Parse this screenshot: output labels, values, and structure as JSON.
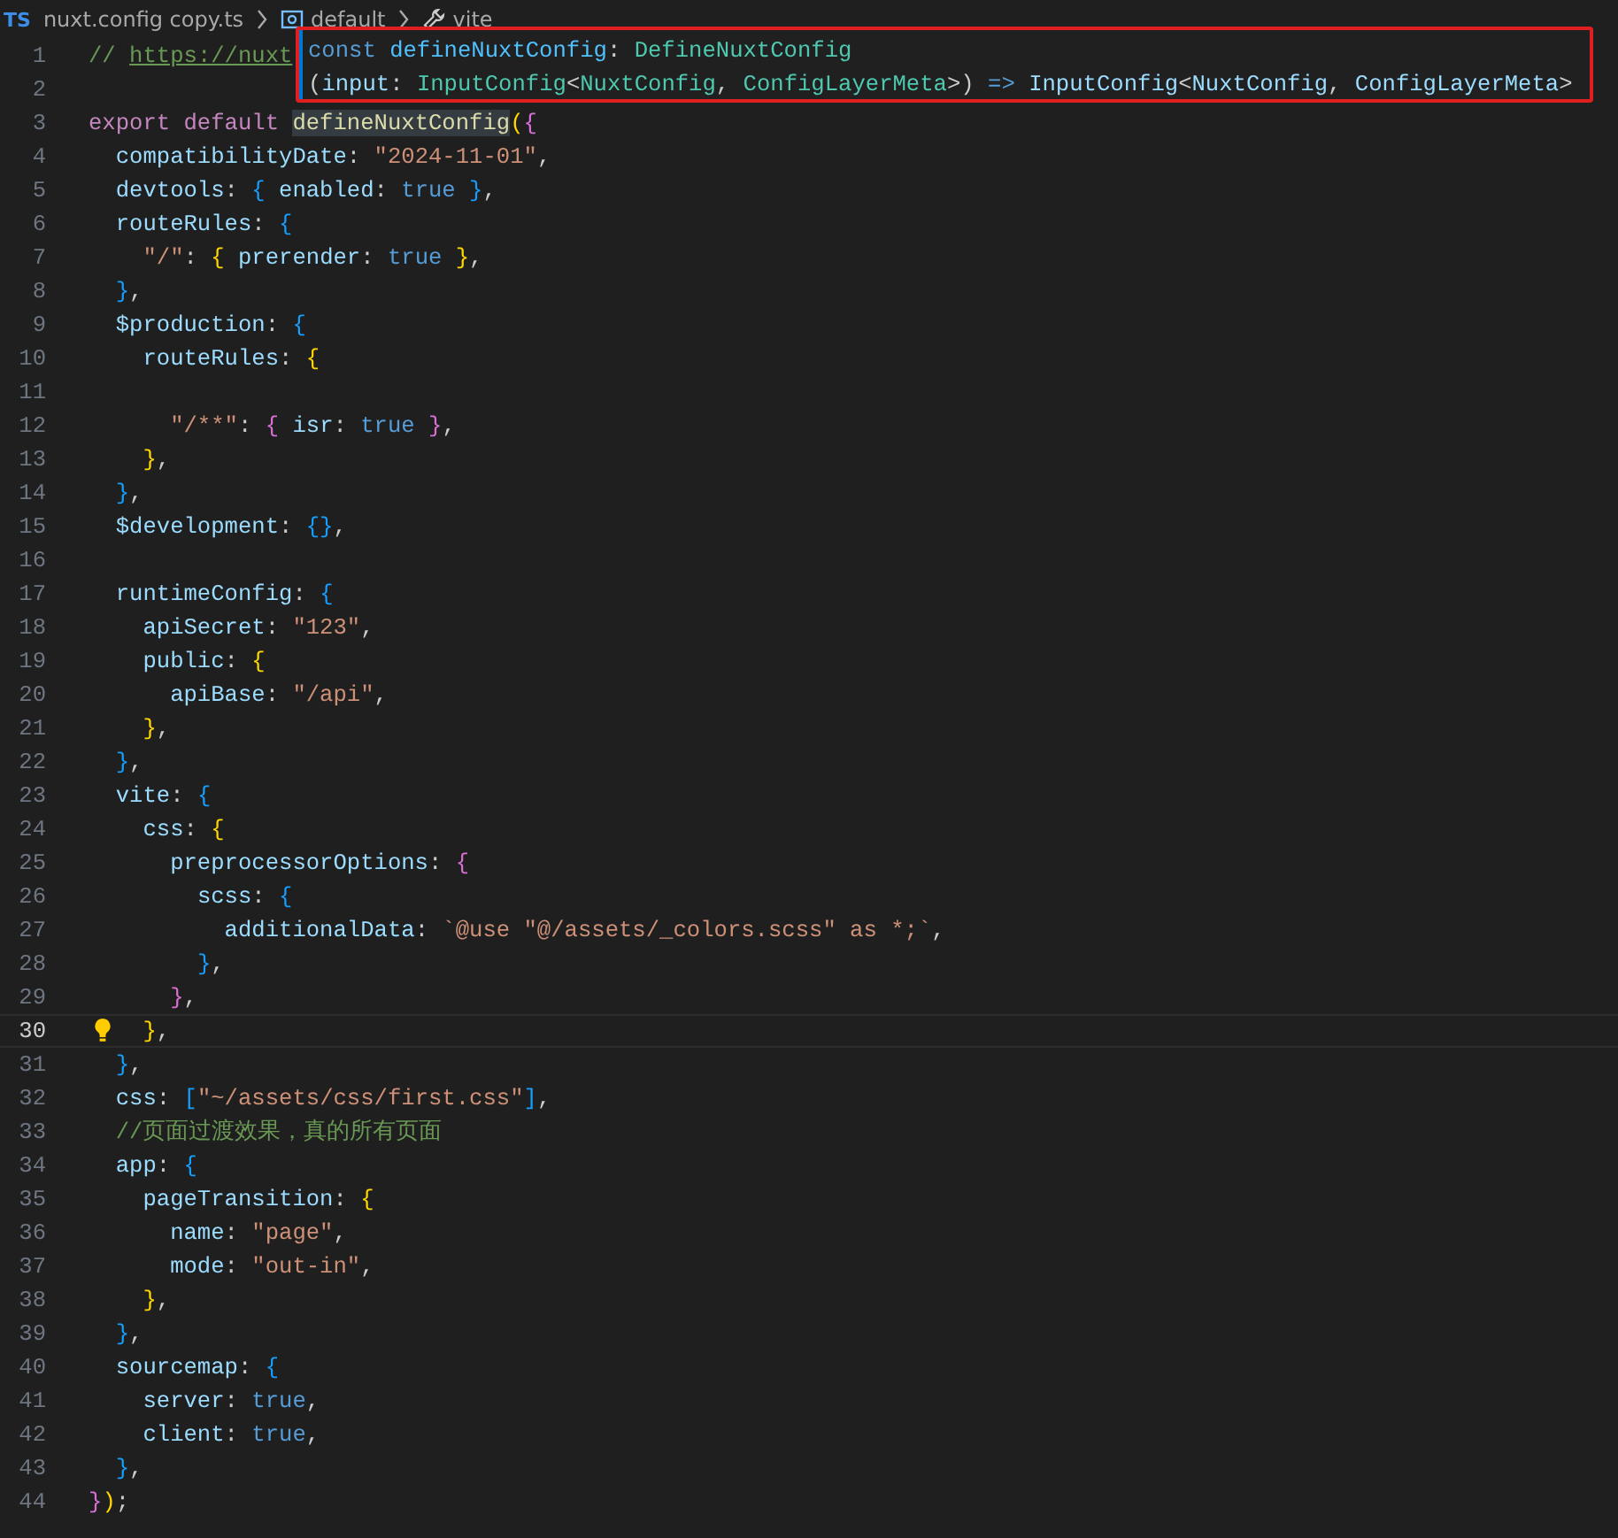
{
  "breadcrumb": {
    "file_badge": "TS",
    "file": "nuxt.config copy.ts",
    "items": [
      "default",
      "vite"
    ]
  },
  "hover": {
    "lines": [
      [
        {
          "kind": "c",
          "text": "const "
        },
        {
          "kind": "var",
          "text": "defineNuxtConfig"
        },
        {
          "kind": "p",
          "text": ": "
        },
        {
          "kind": "type",
          "text": "DefineNuxtConfig"
        }
      ],
      [
        {
          "kind": "p",
          "text": "("
        },
        {
          "kind": "v",
          "text": "input"
        },
        {
          "kind": "p",
          "text": ": "
        },
        {
          "kind": "type",
          "text": "InputConfig"
        },
        {
          "kind": "p",
          "text": "<"
        },
        {
          "kind": "type",
          "text": "NuxtConfig"
        },
        {
          "kind": "p",
          "text": ", "
        },
        {
          "kind": "type",
          "text": "ConfigLayerMeta"
        },
        {
          "kind": "p",
          "text": ">) "
        },
        {
          "kind": "c",
          "text": "=> "
        },
        {
          "kind": "v",
          "text": "InputConfig"
        },
        {
          "kind": "p",
          "text": "<"
        },
        {
          "kind": "v",
          "text": "NuxtConfig"
        },
        {
          "kind": "p",
          "text": ", "
        },
        {
          "kind": "v",
          "text": "ConfigLayerMeta"
        },
        {
          "kind": "p",
          "text": ">"
        }
      ]
    ]
  },
  "lines": [
    {
      "number": "1",
      "current": false,
      "tokens": [
        {
          "kind": "m",
          "text": "// "
        },
        {
          "kind": "u",
          "text": "https://nuxt"
        }
      ]
    },
    {
      "number": "2",
      "current": false
    },
    {
      "number": "3",
      "current": false,
      "tokens": [
        {
          "kind": "k",
          "text": "export default "
        },
        {
          "kind": "fh",
          "text": "defineNuxtConfig"
        },
        {
          "kind": "b1",
          "text": "("
        },
        {
          "kind": "b2",
          "text": "{"
        }
      ]
    },
    {
      "number": "4",
      "current": false,
      "tokens": [
        {
          "kind": "v",
          "text": "  compatibilityDate"
        },
        {
          "kind": "p",
          "text": ": "
        },
        {
          "kind": "s",
          "text": "\"2024-11-01\""
        },
        {
          "kind": "p",
          "text": ","
        }
      ]
    },
    {
      "number": "5",
      "current": false,
      "tokens": [
        {
          "kind": "v",
          "text": "  devtools"
        },
        {
          "kind": "p",
          "text": ": "
        },
        {
          "kind": "b3",
          "text": "{"
        },
        {
          "kind": "v",
          "text": " enabled"
        },
        {
          "kind": "p",
          "text": ": "
        },
        {
          "kind": "c",
          "text": "true"
        },
        {
          "kind": "b3",
          "text": " }"
        },
        {
          "kind": "p",
          "text": ","
        }
      ]
    },
    {
      "number": "6",
      "current": false,
      "tokens": [
        {
          "kind": "v",
          "text": "  routeRules"
        },
        {
          "kind": "p",
          "text": ": "
        },
        {
          "kind": "b3",
          "text": "{"
        }
      ]
    },
    {
      "number": "7",
      "current": false,
      "tokens": [
        {
          "kind": "s",
          "text": "    \"/\""
        },
        {
          "kind": "p",
          "text": ": "
        },
        {
          "kind": "b1",
          "text": "{"
        },
        {
          "kind": "v",
          "text": " prerender"
        },
        {
          "kind": "p",
          "text": ": "
        },
        {
          "kind": "c",
          "text": "true"
        },
        {
          "kind": "b1",
          "text": " }"
        },
        {
          "kind": "p",
          "text": ","
        }
      ]
    },
    {
      "number": "8",
      "current": false,
      "tokens": [
        {
          "kind": "b3",
          "text": "  }"
        },
        {
          "kind": "p",
          "text": ","
        }
      ]
    },
    {
      "number": "9",
      "current": false,
      "tokens": [
        {
          "kind": "v",
          "text": "  $production"
        },
        {
          "kind": "p",
          "text": ": "
        },
        {
          "kind": "b3",
          "text": "{"
        }
      ]
    },
    {
      "number": "10",
      "current": false,
      "tokens": [
        {
          "kind": "v",
          "text": "    routeRules"
        },
        {
          "kind": "p",
          "text": ": "
        },
        {
          "kind": "b1",
          "text": "{"
        }
      ]
    },
    {
      "number": "11",
      "current": false
    },
    {
      "number": "12",
      "current": false,
      "tokens": [
        {
          "kind": "s",
          "text": "      \"/**\""
        },
        {
          "kind": "p",
          "text": ": "
        },
        {
          "kind": "b2",
          "text": "{"
        },
        {
          "kind": "v",
          "text": " isr"
        },
        {
          "kind": "p",
          "text": ": "
        },
        {
          "kind": "c",
          "text": "true"
        },
        {
          "kind": "b2",
          "text": " }"
        },
        {
          "kind": "p",
          "text": ","
        }
      ]
    },
    {
      "number": "13",
      "current": false,
      "tokens": [
        {
          "kind": "b1",
          "text": "    }"
        },
        {
          "kind": "p",
          "text": ","
        }
      ]
    },
    {
      "number": "14",
      "current": false,
      "tokens": [
        {
          "kind": "b3",
          "text": "  }"
        },
        {
          "kind": "p",
          "text": ","
        }
      ]
    },
    {
      "number": "15",
      "current": false,
      "tokens": [
        {
          "kind": "v",
          "text": "  $development"
        },
        {
          "kind": "p",
          "text": ": "
        },
        {
          "kind": "b3",
          "text": "{}"
        },
        {
          "kind": "p",
          "text": ","
        }
      ]
    },
    {
      "number": "16",
      "current": false
    },
    {
      "number": "17",
      "current": false,
      "tokens": [
        {
          "kind": "v",
          "text": "  runtimeConfig"
        },
        {
          "kind": "p",
          "text": ": "
        },
        {
          "kind": "b3",
          "text": "{"
        }
      ]
    },
    {
      "number": "18",
      "current": false,
      "tokens": [
        {
          "kind": "v",
          "text": "    apiSecret"
        },
        {
          "kind": "p",
          "text": ": "
        },
        {
          "kind": "s",
          "text": "\"123\""
        },
        {
          "kind": "p",
          "text": ","
        }
      ]
    },
    {
      "number": "19",
      "current": false,
      "tokens": [
        {
          "kind": "v",
          "text": "    public"
        },
        {
          "kind": "p",
          "text": ": "
        },
        {
          "kind": "b1",
          "text": "{"
        }
      ]
    },
    {
      "number": "20",
      "current": false,
      "tokens": [
        {
          "kind": "v",
          "text": "      apiBase"
        },
        {
          "kind": "p",
          "text": ": "
        },
        {
          "kind": "s",
          "text": "\"/api\""
        },
        {
          "kind": "p",
          "text": ","
        }
      ]
    },
    {
      "number": "21",
      "current": false,
      "tokens": [
        {
          "kind": "b1",
          "text": "    }"
        },
        {
          "kind": "p",
          "text": ","
        }
      ]
    },
    {
      "number": "22",
      "current": false,
      "tokens": [
        {
          "kind": "b3",
          "text": "  }"
        },
        {
          "kind": "p",
          "text": ","
        }
      ]
    },
    {
      "number": "23",
      "current": false,
      "tokens": [
        {
          "kind": "v",
          "text": "  vite"
        },
        {
          "kind": "p",
          "text": ": "
        },
        {
          "kind": "b3",
          "text": "{"
        }
      ]
    },
    {
      "number": "24",
      "current": false,
      "tokens": [
        {
          "kind": "v",
          "text": "    css"
        },
        {
          "kind": "p",
          "text": ": "
        },
        {
          "kind": "b1",
          "text": "{"
        }
      ]
    },
    {
      "number": "25",
      "current": false,
      "tokens": [
        {
          "kind": "v",
          "text": "      preprocessorOptions"
        },
        {
          "kind": "p",
          "text": ": "
        },
        {
          "kind": "b2",
          "text": "{"
        }
      ]
    },
    {
      "number": "26",
      "current": false,
      "tokens": [
        {
          "kind": "v",
          "text": "        scss"
        },
        {
          "kind": "p",
          "text": ": "
        },
        {
          "kind": "b3",
          "text": "{"
        }
      ]
    },
    {
      "number": "27",
      "current": false,
      "tokens": [
        {
          "kind": "v",
          "text": "          additionalData"
        },
        {
          "kind": "p",
          "text": ": "
        },
        {
          "kind": "s",
          "text": "`@use \"@/assets/_colors.scss\" as *;`"
        },
        {
          "kind": "p",
          "text": ","
        }
      ]
    },
    {
      "number": "28",
      "current": false,
      "tokens": [
        {
          "kind": "b3",
          "text": "        }"
        },
        {
          "kind": "p",
          "text": ","
        }
      ]
    },
    {
      "number": "29",
      "current": false,
      "tokens": [
        {
          "kind": "b2",
          "text": "      }"
        },
        {
          "kind": "p",
          "text": ","
        }
      ]
    },
    {
      "number": "30",
      "current": true,
      "tokens": [
        {
          "kind": "b1",
          "text": "    }"
        },
        {
          "kind": "p",
          "text": ","
        }
      ]
    },
    {
      "number": "31",
      "current": false,
      "tokens": [
        {
          "kind": "b3",
          "text": "  }"
        },
        {
          "kind": "p",
          "text": ","
        }
      ]
    },
    {
      "number": "32",
      "current": false,
      "tokens": [
        {
          "kind": "v",
          "text": "  css"
        },
        {
          "kind": "p",
          "text": ": "
        },
        {
          "kind": "b3",
          "text": "["
        },
        {
          "kind": "s",
          "text": "\"~/assets/css/first.css\""
        },
        {
          "kind": "b3",
          "text": "]"
        },
        {
          "kind": "p",
          "text": ","
        }
      ]
    },
    {
      "number": "33",
      "current": false,
      "tokens": [
        {
          "kind": "m",
          "text": "  //页面过渡效果，真的所有页面"
        }
      ]
    },
    {
      "number": "34",
      "current": false,
      "tokens": [
        {
          "kind": "v",
          "text": "  app"
        },
        {
          "kind": "p",
          "text": ": "
        },
        {
          "kind": "b3",
          "text": "{"
        }
      ]
    },
    {
      "number": "35",
      "current": false,
      "tokens": [
        {
          "kind": "v",
          "text": "    pageTransition"
        },
        {
          "kind": "p",
          "text": ": "
        },
        {
          "kind": "b1",
          "text": "{"
        }
      ]
    },
    {
      "number": "36",
      "current": false,
      "tokens": [
        {
          "kind": "v",
          "text": "      name"
        },
        {
          "kind": "p",
          "text": ": "
        },
        {
          "kind": "s",
          "text": "\"page\""
        },
        {
          "kind": "p",
          "text": ","
        }
      ]
    },
    {
      "number": "37",
      "current": false,
      "tokens": [
        {
          "kind": "v",
          "text": "      mode"
        },
        {
          "kind": "p",
          "text": ": "
        },
        {
          "kind": "s",
          "text": "\"out-in\""
        },
        {
          "kind": "p",
          "text": ","
        }
      ]
    },
    {
      "number": "38",
      "current": false,
      "tokens": [
        {
          "kind": "b1",
          "text": "    }"
        },
        {
          "kind": "p",
          "text": ","
        }
      ]
    },
    {
      "number": "39",
      "current": false,
      "tokens": [
        {
          "kind": "b3",
          "text": "  }"
        },
        {
          "kind": "p",
          "text": ","
        }
      ]
    },
    {
      "number": "40",
      "current": false,
      "tokens": [
        {
          "kind": "v",
          "text": "  sourcemap"
        },
        {
          "kind": "p",
          "text": ": "
        },
        {
          "kind": "b3",
          "text": "{"
        }
      ]
    },
    {
      "number": "41",
      "current": false,
      "tokens": [
        {
          "kind": "v",
          "text": "    server"
        },
        {
          "kind": "p",
          "text": ": "
        },
        {
          "kind": "c",
          "text": "true"
        },
        {
          "kind": "p",
          "text": ","
        }
      ]
    },
    {
      "number": "42",
      "current": false,
      "tokens": [
        {
          "kind": "v",
          "text": "    client"
        },
        {
          "kind": "p",
          "text": ": "
        },
        {
          "kind": "c",
          "text": "true"
        },
        {
          "kind": "p",
          "text": ","
        }
      ]
    },
    {
      "number": "43",
      "current": false,
      "tokens": [
        {
          "kind": "b3",
          "text": "  }"
        },
        {
          "kind": "p",
          "text": ","
        }
      ]
    },
    {
      "number": "44",
      "current": false,
      "tokens": [
        {
          "kind": "b2",
          "text": "}"
        },
        {
          "kind": "b1",
          "text": ")"
        },
        {
          "kind": "p",
          "text": ";"
        }
      ]
    }
  ]
}
